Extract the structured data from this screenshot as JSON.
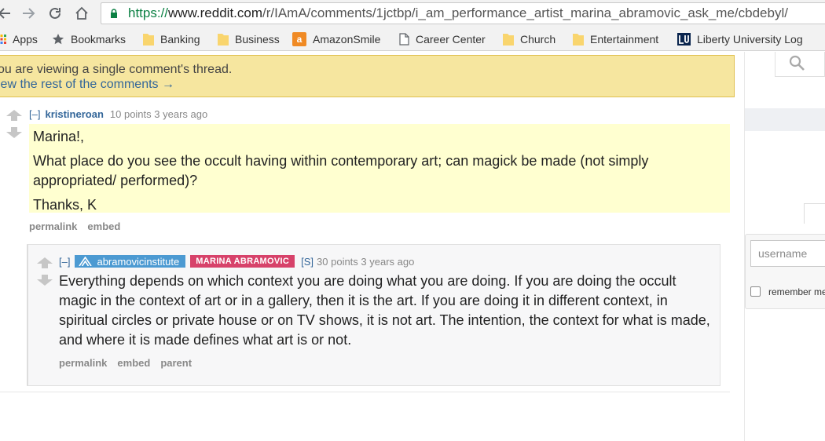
{
  "browser": {
    "url_scheme": "https://",
    "url_host": "www.reddit.com",
    "url_path": "/r/IAmA/comments/1jctbp/i_am_performance_artist_marina_abramovic_ask_me/cbdebyl/",
    "nav_icons": [
      "back-arrow-icon",
      "forward-arrow-icon",
      "reload-icon",
      "home-icon"
    ],
    "bookmarks": [
      {
        "label": "Apps",
        "icon": "apps-grid-icon"
      },
      {
        "label": "Bookmarks",
        "icon": "star-icon"
      },
      {
        "label": "Banking",
        "icon": "folder-icon"
      },
      {
        "label": "Business",
        "icon": "folder-icon"
      },
      {
        "label": "AmazonSmile",
        "icon": "amazon-icon"
      },
      {
        "label": "Career Center",
        "icon": "page-icon"
      },
      {
        "label": "Church",
        "icon": "folder-icon"
      },
      {
        "label": "Entertainment",
        "icon": "folder-icon"
      },
      {
        "label": "Liberty University Log",
        "icon": "liberty-logo-icon"
      }
    ]
  },
  "banner": {
    "line1": "ou are viewing a single comment's thread.",
    "line2": "iew the rest of the comments →"
  },
  "sidebar": {
    "username_placeholder": "username",
    "remember_label": "remember me"
  },
  "comment": {
    "toggle": "[–]",
    "author": "kristineroan",
    "meta": "10 points 3 years ago",
    "body": [
      "Marina!,",
      "What place do you see the occult having within contemporary art; can magick be made (not simply appropriated/ performed)?",
      "Thanks, K"
    ],
    "links": [
      "permalink",
      "embed"
    ]
  },
  "reply": {
    "toggle": "[–]",
    "author": "abramovicinstitute",
    "flair": "MARINA ABRAMOVIC",
    "submitter": "[S]",
    "meta": "30 points 3 years ago",
    "body": "Everything depends on which context you are doing what you are doing. If you are doing the occult magic in the context of art or in a gallery, then it is the art. If you are doing it in different context, in spiritual circles or private house or on TV shows, it is not art. The intention, the context for what is made, and where it is made defines what art is or not.",
    "links": [
      "permalink",
      "embed",
      "parent"
    ]
  },
  "colors": {
    "link_blue": "#336699",
    "banner_bg": "#f6e69f",
    "highlight_bg": "#ffffd0",
    "flair_bg": "#d7426a",
    "badge_bg": "#4c9ad2",
    "secure_green": "#0b8043"
  }
}
